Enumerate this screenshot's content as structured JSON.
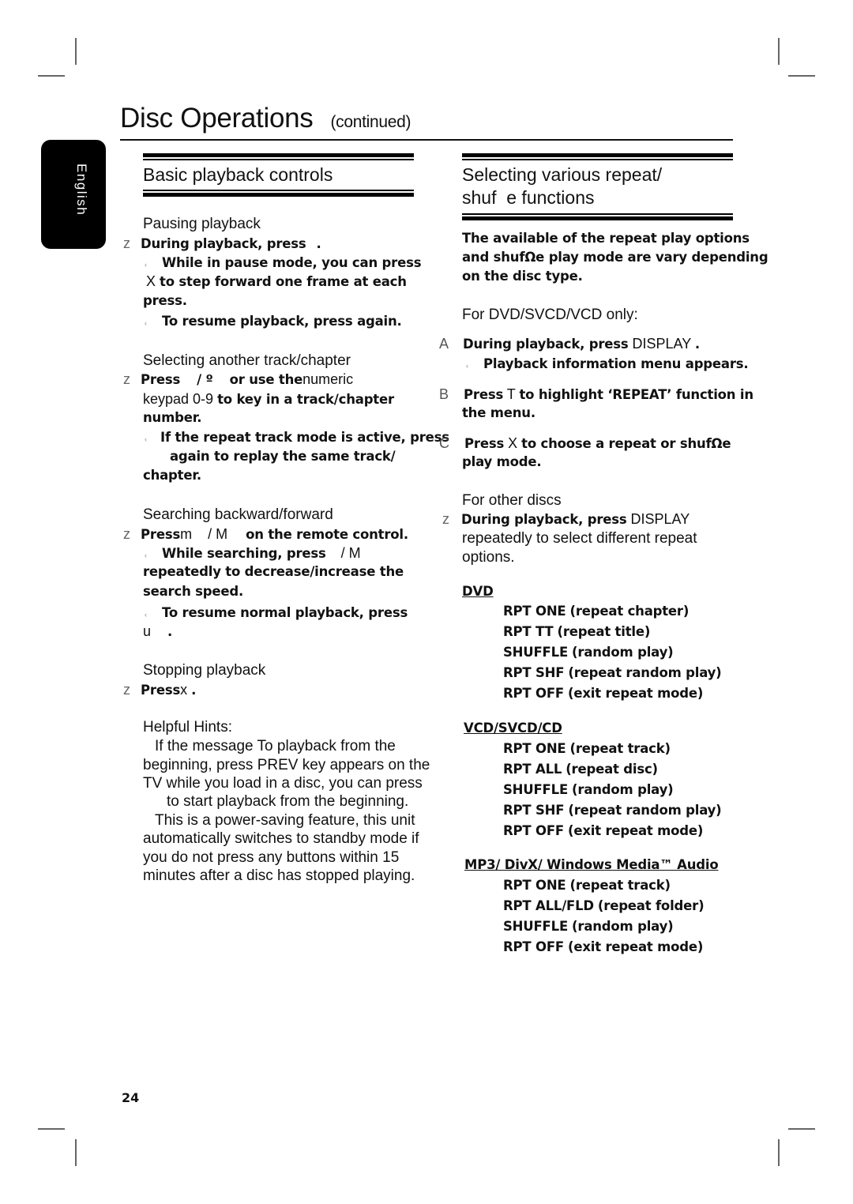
{
  "header": {
    "title": "Disc Operations",
    "continued": "(continued)"
  },
  "language_tab": "English",
  "left": {
    "section_title": "Basic playback controls",
    "pausing": {
      "heading": "Pausing playback",
      "bullet": "z",
      "step": "During playback, press",
      "step_end": ".",
      "note1_a": "While in pause mode, you can press",
      "note1_key": "X",
      "note1_b": "to step forward one frame at each",
      "note1_c": "press.",
      "note2": "To resume playback, press  again."
    },
    "selecting": {
      "heading": "Selecting another track/chapter",
      "bullet": "z",
      "step_a": "Press",
      "step_keys": "/ º",
      "step_b": "or use the",
      "step_c": "numeric",
      "step_d": "keypad 0-9",
      "step_e": "to key in a track/chapter",
      "step_f": "number.",
      "note_a": "If the repeat track mode is active, press",
      "note_b": "again to replay the same track/",
      "note_c": "chapter."
    },
    "searching": {
      "heading": "Searching backward/forward",
      "bullet": "z",
      "step_a": "Press",
      "step_keys": "m    / M",
      "step_b": "on the remote control.",
      "note1_a": "While searching, press",
      "note1_keys": "/ M",
      "note1_b": "repeatedly to decrease/increase the",
      "note1_c": "search speed.",
      "note2_a": "To resume normal playback, press",
      "note2_key": "u",
      "note2_end": "."
    },
    "stopping": {
      "heading": "Stopping playback",
      "bullet": "z",
      "step_a": "Press",
      "step_key": "x",
      "step_end": "."
    },
    "hints": {
      "heading": "Helpful Hints:",
      "lines": [
        "If the message  To playback from the",
        "beginning, press PREV key  appears on the",
        "TV while you load in a disc, you can press",
        "to start playback from the beginning.",
        "This is a power-saving feature, this unit",
        "automatically switches to standby mode if",
        "you do not press any buttons within 15",
        "minutes after a disc has stopped playing."
      ]
    }
  },
  "right": {
    "section_title_1": "Selecting various repeat/",
    "section_title_2": "shuf  e functions",
    "intro": [
      "The available of the repeat play options",
      "and shufΩe play mode are vary depending",
      "on the disc type."
    ],
    "dvd_only": {
      "heading": "For DVD/SVCD/VCD only:",
      "steps": [
        {
          "marker": "A",
          "a": "During playback, press",
          "key": "DISPLAY",
          "end": "."
        },
        {
          "marker": "B",
          "a": "Press",
          "key": "T",
          "b": "to highlight ‘REPEAT’ function in",
          "c": "the menu."
        },
        {
          "marker": "C",
          "a": "Press",
          "key": "X",
          "b": "to choose a repeat or shufΩe",
          "c": "play mode."
        }
      ],
      "note": "Playback information menu appears."
    },
    "other": {
      "heading": "For other discs",
      "bullet": "z",
      "a": "During playback, press",
      "key": "DISPLAY",
      "b": "repeatedly to select different repeat",
      "c": "options."
    },
    "groups": [
      {
        "title": "DVD",
        "items": [
          {
            "code": "RPT ONE",
            "desc": "(repeat chapter)"
          },
          {
            "code": "RPT TT",
            "desc": "(repeat title)"
          },
          {
            "code": "SHUFFLE",
            "desc": "(random play)"
          },
          {
            "code": "RPT SHF",
            "desc": "(repeat random play)"
          },
          {
            "code": "RPT OFF",
            "desc": "(exit repeat mode)"
          }
        ]
      },
      {
        "title": "VCD/SVCD/CD",
        "items": [
          {
            "code": "RPT ONE",
            "desc": "(repeat track)"
          },
          {
            "code": "RPT ALL",
            "desc": "(repeat disc)"
          },
          {
            "code": "SHUFFLE",
            "desc": "(random play)"
          },
          {
            "code": "RPT SHF",
            "desc": "(repeat random play)"
          },
          {
            "code": "RPT OFF",
            "desc": "(exit repeat mode)"
          }
        ]
      },
      {
        "title": "MP3/ DivX/ Windows Media™ Audio",
        "items": [
          {
            "code": "RPT ONE",
            "desc": "(repeat track)"
          },
          {
            "code": "RPT ALL/FLD",
            "desc": "(repeat folder)"
          },
          {
            "code": "SHUFFLE",
            "desc": "(random play)"
          },
          {
            "code": "RPT OFF",
            "desc": "(exit repeat mode)"
          }
        ]
      }
    ]
  },
  "page_number": "24",
  "note_marker": "‹"
}
